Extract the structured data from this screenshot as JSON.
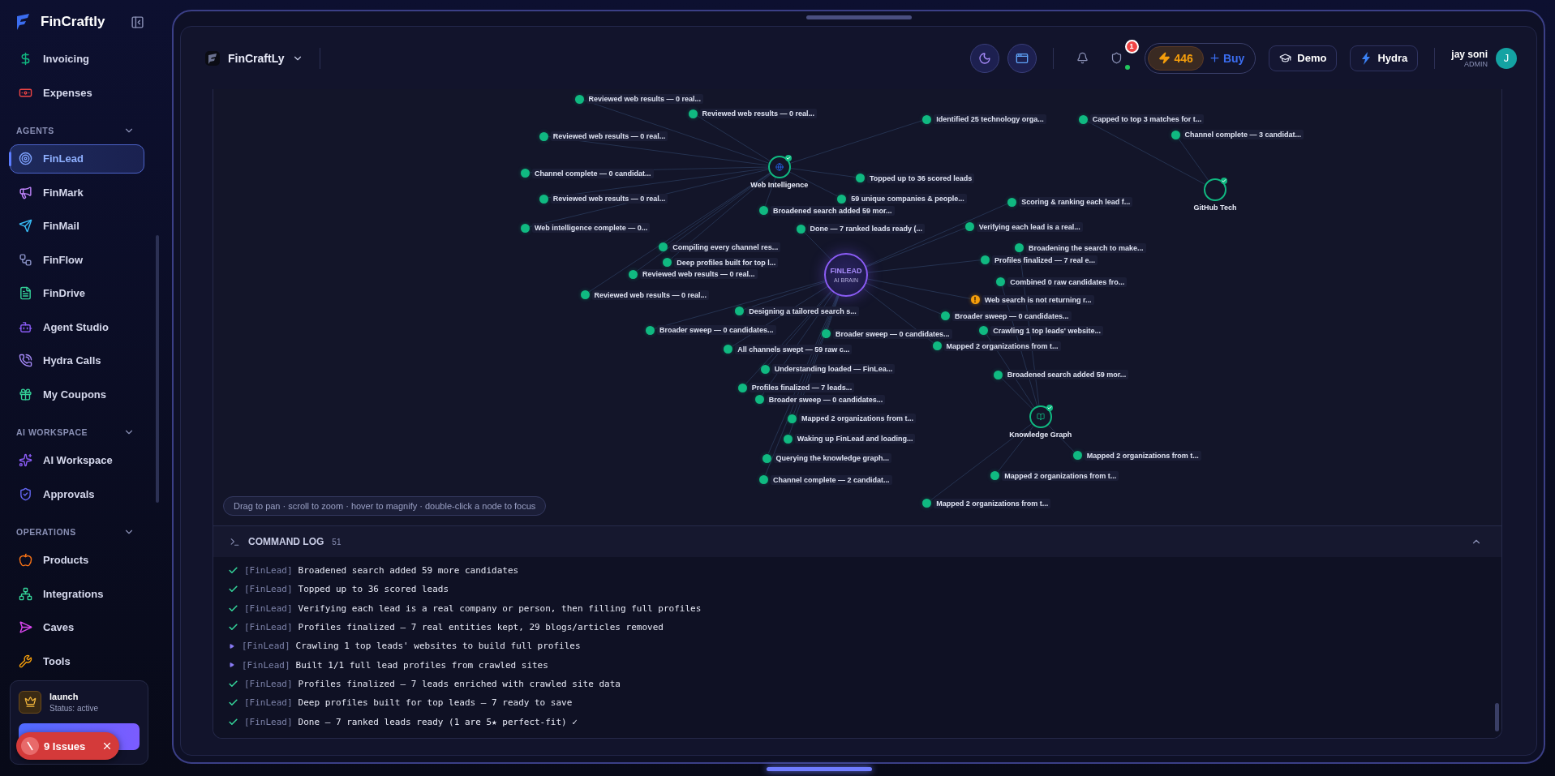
{
  "sidebar": {
    "brand": "FinCraftly",
    "top_items": [
      {
        "label": "Invoicing",
        "selected": false
      },
      {
        "label": "Expenses",
        "selected": false
      }
    ],
    "sections": [
      {
        "title": "AGENTS",
        "expanded": true,
        "items": [
          {
            "label": "FinLead",
            "selected": true
          },
          {
            "label": "FinMark",
            "selected": false
          },
          {
            "label": "FinMail",
            "selected": false
          },
          {
            "label": "FinFlow",
            "selected": false
          },
          {
            "label": "FinDrive",
            "selected": false
          },
          {
            "label": "Agent Studio",
            "selected": false
          },
          {
            "label": "Hydra Calls",
            "selected": false
          },
          {
            "label": "My Coupons",
            "selected": false
          }
        ]
      },
      {
        "title": "AI WORKSPACE",
        "expanded": true,
        "items": [
          {
            "label": "AI Workspace",
            "selected": false
          },
          {
            "label": "Approvals",
            "selected": false
          }
        ]
      },
      {
        "title": "OPERATIONS",
        "expanded": true,
        "items": [
          {
            "label": "Products",
            "selected": false
          },
          {
            "label": "Integrations",
            "selected": false
          },
          {
            "label": "Caves",
            "selected": false
          },
          {
            "label": "Tools",
            "selected": false
          }
        ]
      }
    ],
    "plan_card": {
      "name": "launch",
      "status": "Status: active"
    }
  },
  "issues_badge": {
    "count": "9",
    "label": "Issues"
  },
  "header": {
    "workspace": "FinCraftLy",
    "notifications": "1",
    "credits": "446",
    "buy": "Buy",
    "demo": "Demo",
    "hydra": "Hydra",
    "user": {
      "name": "jay soni",
      "role": "ADMIN",
      "initial": "J"
    }
  },
  "graph": {
    "core": {
      "title": "FINLEAD",
      "subtitle": "AI BRAIN"
    },
    "hubs": [
      {
        "label": "Web Intelligence",
        "complete": true
      },
      {
        "label": "GitHub Tech",
        "complete": true
      },
      {
        "label": "Knowledge Graph",
        "complete": true
      }
    ],
    "nodes": [
      {
        "kind": "step",
        "label": "Reviewed web results — 0 real..."
      },
      {
        "kind": "step",
        "label": "Reviewed web results — 0 real..."
      },
      {
        "kind": "step",
        "label": "Reviewed web results — 0 real..."
      },
      {
        "kind": "step",
        "label": "Channel complete — 0 candidat..."
      },
      {
        "kind": "step",
        "label": "Reviewed web results — 0 real..."
      },
      {
        "kind": "step",
        "label": "Topped up to 36 scored leads"
      },
      {
        "kind": "step",
        "label": "59 unique companies & people..."
      },
      {
        "kind": "step",
        "label": "Broadened search added 59 mor..."
      },
      {
        "kind": "step",
        "label": "Done — 7 ranked leads ready (..."
      },
      {
        "kind": "step",
        "label": "Compiling every channel res..."
      },
      {
        "kind": "step",
        "label": "Web intelligence complete — 0..."
      },
      {
        "kind": "step",
        "label": "Deep profiles built for top l..."
      },
      {
        "kind": "step",
        "label": "Designing a tailored search s..."
      },
      {
        "kind": "step",
        "label": "Reviewed web results — 0 real..."
      },
      {
        "kind": "step",
        "label": "Reviewed web results — 0 real..."
      },
      {
        "kind": "step",
        "label": "Broader sweep — 0 candidates..."
      },
      {
        "kind": "step",
        "label": "All channels swept — 59 raw c..."
      },
      {
        "kind": "step",
        "label": "Understanding loaded — FinLea..."
      },
      {
        "kind": "step",
        "label": "Profiles finalized — 7 leads..."
      },
      {
        "kind": "step",
        "label": "Broader sweep — 0 candidates..."
      },
      {
        "kind": "step",
        "label": "Mapped 2 organizations from t..."
      },
      {
        "kind": "step",
        "label": "Broader sweep — 0 candidates..."
      },
      {
        "kind": "step",
        "label": "Waking up FinLead and loading..."
      },
      {
        "kind": "step",
        "label": "Querying the knowledge graph..."
      },
      {
        "kind": "step",
        "label": "Channel complete — 2 candidat..."
      },
      {
        "kind": "step",
        "label": "Identified 25 technology orga..."
      },
      {
        "kind": "step",
        "label": "Capped to top 3 matches for t..."
      },
      {
        "kind": "step",
        "label": "Channel complete — 3 candidat..."
      },
      {
        "kind": "step",
        "label": "Scoring & ranking each lead f..."
      },
      {
        "kind": "step",
        "label": "Verifying each lead is a real..."
      },
      {
        "kind": "step",
        "label": "Broadening the search to make..."
      },
      {
        "kind": "step",
        "label": "Profiles finalized — 7 real e..."
      },
      {
        "kind": "step",
        "label": "Combined 0 raw candidates fro..."
      },
      {
        "kind": "warning",
        "label": "Web search is not returning r..."
      },
      {
        "kind": "step",
        "label": "Broader sweep — 0 candidates..."
      },
      {
        "kind": "step",
        "label": "Crawling 1 top leads' website..."
      },
      {
        "kind": "step",
        "label": "Mapped 2 organizations from t..."
      },
      {
        "kind": "step",
        "label": "Broadened search added 59 mor..."
      },
      {
        "kind": "step",
        "label": "Mapped 2 organizations from t..."
      },
      {
        "kind": "step",
        "label": "Mapped 2 organizations from t..."
      },
      {
        "kind": "step",
        "label": "Mapped 2 organizations from t..."
      }
    ],
    "hint": "Drag to pan · scroll to zoom · hover to magnify · double-click a node to focus"
  },
  "command_log": {
    "title": "COMMAND LOG",
    "count": "51",
    "expanded": true,
    "lines": [
      {
        "kind": "done",
        "tag": "[FinLead]",
        "text": "Broadened search added 59 more candidates"
      },
      {
        "kind": "done",
        "tag": "[FinLead]",
        "text": "Topped up to 36 scored leads"
      },
      {
        "kind": "done",
        "tag": "[FinLead]",
        "text": "Verifying each lead is a real company or person, then filling full profiles"
      },
      {
        "kind": "done",
        "tag": "[FinLead]",
        "text": "Profiles finalized — 7 real entities kept, 29 blogs/articles removed"
      },
      {
        "kind": "progress",
        "tag": "[FinLead]",
        "text": "Crawling 1 top leads' websites to build full profiles"
      },
      {
        "kind": "progress",
        "tag": "[FinLead]",
        "text": "Built 1/1 full lead profiles from crawled sites"
      },
      {
        "kind": "done",
        "tag": "[FinLead]",
        "text": "Profiles finalized — 7 leads enriched with crawled site data"
      },
      {
        "kind": "done",
        "tag": "[FinLead]",
        "text": "Deep profiles built for top leads — 7 ready to save"
      },
      {
        "kind": "done",
        "tag": "[FinLead]",
        "text": "Done — 7 ranked leads ready (1 are 5★ perfect-fit) ✓"
      }
    ]
  }
}
